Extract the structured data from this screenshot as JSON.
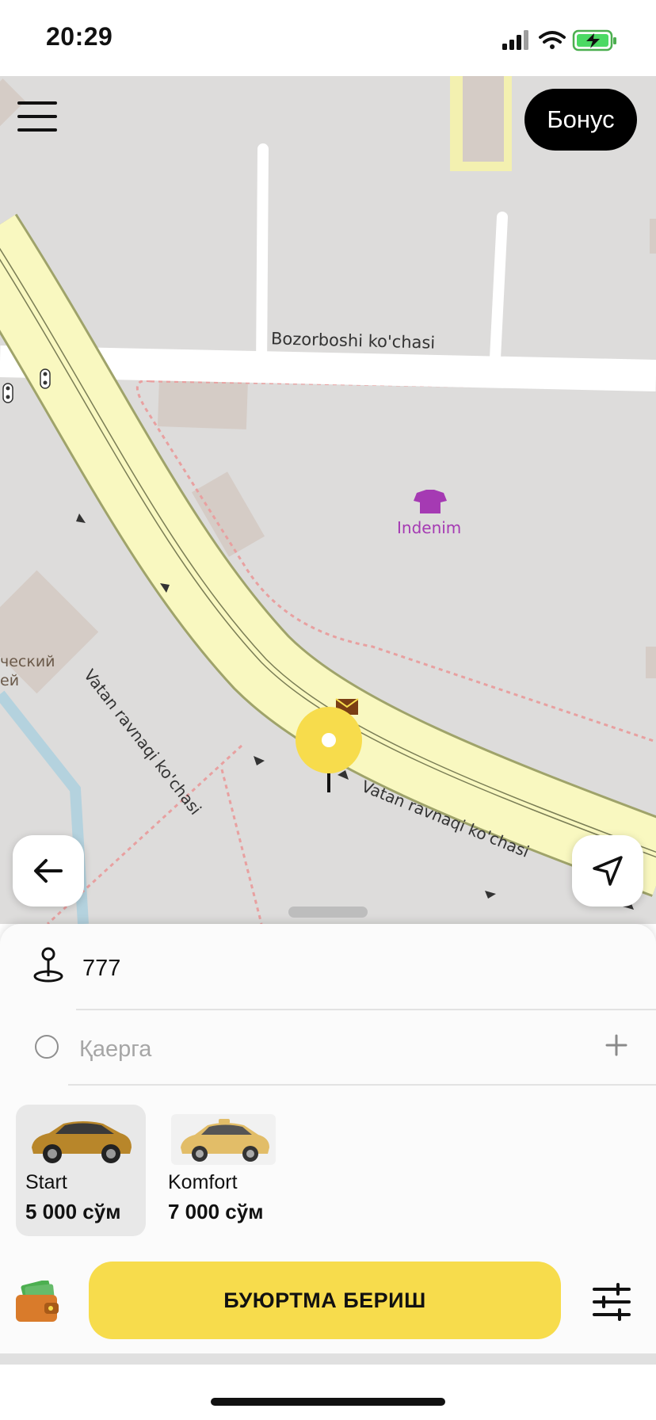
{
  "status_bar": {
    "time": "20:29"
  },
  "map": {
    "labels": {
      "street_top": "Bozorboshi ko'chasi",
      "street_diag": "Vatan ravnaqi ko'chasi",
      "street_right": "Vatan ravnaqi ko'chasi",
      "poi": "Indenim",
      "museum_1": "ческий",
      "museum_2": "ей"
    }
  },
  "header": {
    "bonus_label": "Бонус"
  },
  "route": {
    "from_value": "777",
    "to_placeholder": "Қаерга"
  },
  "tariffs": [
    {
      "name": "Start",
      "price": "5 000 сўм",
      "selected": true
    },
    {
      "name": "Komfort",
      "price": "7 000 сўм",
      "selected": false
    }
  ],
  "order_button_label": "БУЮРТМА БЕРИШ",
  "colors": {
    "accent": "#f7dc4c",
    "road": "#f9f8c0",
    "map_background": "#dddcdb",
    "poi": "#a53ab3"
  },
  "icons": [
    "hamburger-menu-icon",
    "back-arrow-icon",
    "navigation-arrow-icon",
    "map-pin-icon",
    "location-pin-icon",
    "plus-icon",
    "wallet-icon",
    "filter-sliders-icon"
  ]
}
